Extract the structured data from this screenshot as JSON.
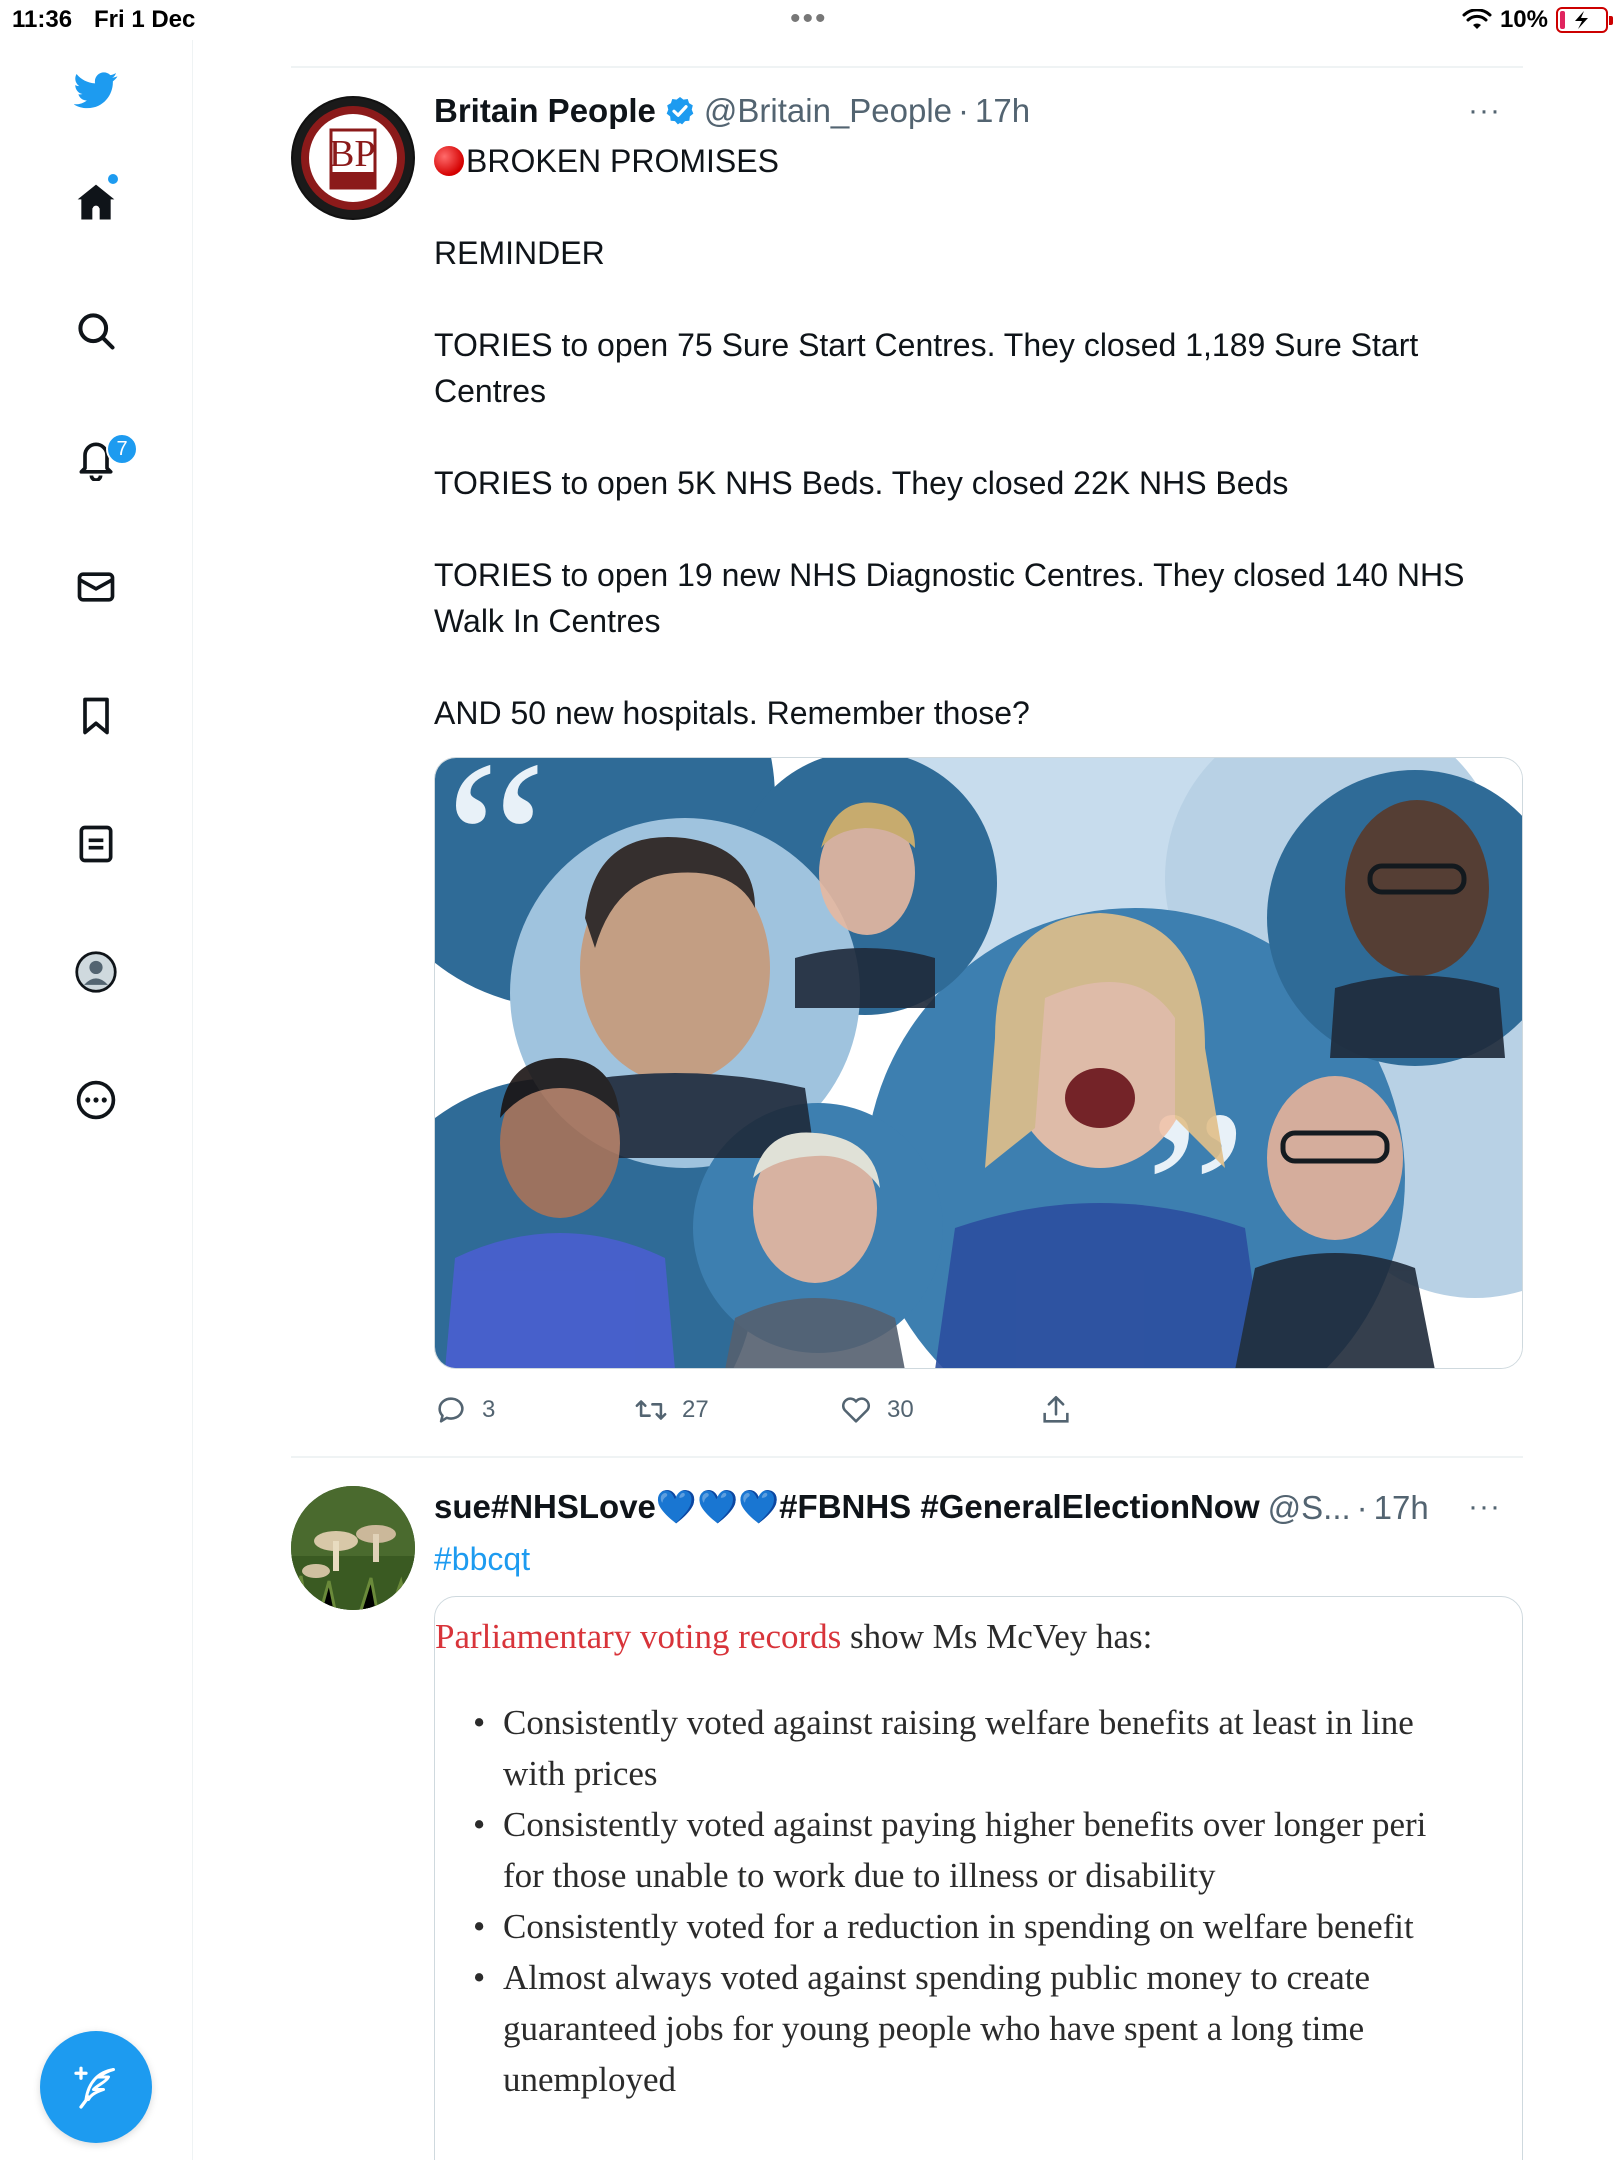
{
  "status_bar": {
    "time": "11:36",
    "date": "Fri 1 Dec",
    "battery": "10%"
  },
  "sidebar": {
    "notifications_badge": "7"
  },
  "tweets": [
    {
      "name": "Britain People",
      "handle": "@Britain_People",
      "separator": "·",
      "time": "17h",
      "avatar_text": "BP",
      "more": "···",
      "lines": [
        "BROKEN PROMISES",
        "",
        "REMINDER",
        "",
        "TORIES to open 75 Sure Start Centres. They closed 1,189 Sure Start",
        "Centres",
        "",
        "TORIES to open 5K NHS Beds. They closed 22K NHS Beds",
        "",
        "TORIES to open 19 new NHS Diagnostic Centres. They closed 140 NHS",
        "Walk In Centres",
        "",
        "AND 50 new hospitals. Remember those?"
      ],
      "replies": "3",
      "retweets": "27",
      "likes": "30"
    },
    {
      "name": "sue#NHSLove💙💙💙#FBNHS #GeneralElectionNow",
      "handle": "@S...",
      "separator": "·",
      "time": "17h",
      "more": "···",
      "hashtag": "#bbcqt",
      "doc_intro_red": "Parliamentary voting records",
      "doc_intro_rest": " show Ms McVey has:",
      "doc_lines": [
        "Consistently voted against raising welfare benefits at least in line",
        "with prices",
        "Consistently voted against paying higher benefits over longer peri",
        "for those unable to work due to illness or disability",
        "Consistently voted for a reduction in spending on welfare benefit",
        "Almost always voted against spending public money to create",
        "guaranteed jobs for young people who have spent a long time",
        "unemployed"
      ]
    }
  ],
  "colors": {
    "brand_blue": "#1d9bf0",
    "text_primary": "#0f1419",
    "text_secondary": "#536471",
    "doc_red": "#d8343a"
  }
}
